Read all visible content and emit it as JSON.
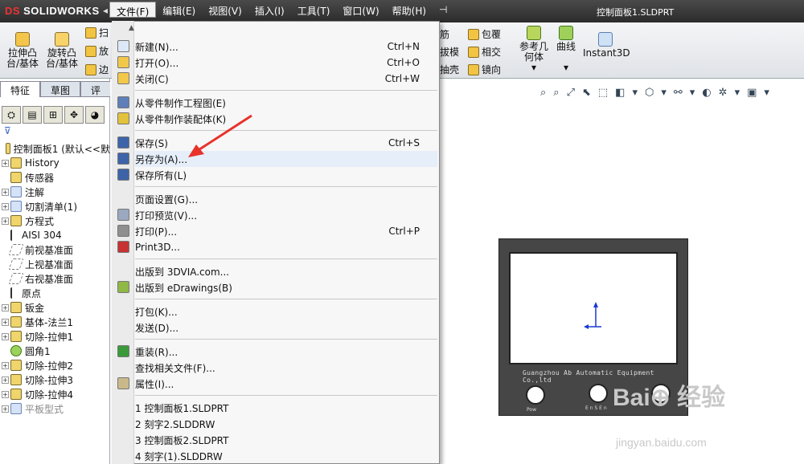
{
  "app": {
    "logo": "SOLIDWORKS",
    "logo_mark": "DS",
    "doc_title": "控制面板1.SLDPRT",
    "collapse": "◂"
  },
  "menubar": [
    {
      "label": "文件(F)",
      "active": true
    },
    {
      "label": "编辑(E)"
    },
    {
      "label": "视图(V)"
    },
    {
      "label": "插入(I)"
    },
    {
      "label": "工具(T)"
    },
    {
      "label": "窗口(W)"
    },
    {
      "label": "帮助(H)"
    },
    {
      "label": "⊣"
    }
  ],
  "commands": {
    "extrude_boss": [
      "拉伸凸",
      "台/基体"
    ],
    "revolve_boss": [
      "旋转凸",
      "台/基体"
    ],
    "frag1": "扫",
    "frag2": "放",
    "frag3": "边",
    "rib": "筋",
    "draft": "拔模",
    "shell": "抽壳",
    "wrap": "包覆",
    "intersect": "相交",
    "mirror": "镜向",
    "ref_geom": [
      "参考几",
      "何体"
    ],
    "curves": "曲线",
    "instant3d": "Instant3D",
    "dropdown": "▾"
  },
  "panel_tabs": [
    "特征",
    "草图",
    "评"
  ],
  "feature_icons": [
    "⛭",
    "▤",
    "⊞",
    "✥",
    "◕"
  ],
  "filter_icon": "⊽",
  "tree": [
    {
      "label": "控制面板1 (默认<<默",
      "pm": "",
      "icon": "part"
    },
    {
      "label": "History",
      "pm": "+",
      "icon": "folder"
    },
    {
      "label": "传感器",
      "pm": "",
      "icon": "folder"
    },
    {
      "label": "注解",
      "pm": "+",
      "icon": "annot"
    },
    {
      "label": "切割清单(1)",
      "pm": "+",
      "icon": "blue"
    },
    {
      "label": "方程式",
      "pm": "+",
      "icon": "folder"
    },
    {
      "label": "AISI 304",
      "pm": "",
      "icon": "material"
    },
    {
      "label": "前视基准面",
      "pm": "",
      "icon": "plane"
    },
    {
      "label": "上视基准面",
      "pm": "",
      "icon": "plane"
    },
    {
      "label": "右视基准面",
      "pm": "",
      "icon": "plane"
    },
    {
      "label": "原点",
      "pm": "",
      "icon": "origin"
    },
    {
      "label": "钣金",
      "pm": "+",
      "icon": "folder"
    },
    {
      "label": "基体-法兰1",
      "pm": "+",
      "icon": "folder"
    },
    {
      "label": "切除-拉伸1",
      "pm": "+",
      "icon": "folder"
    },
    {
      "label": "圆角1",
      "pm": "",
      "icon": "green"
    },
    {
      "label": "切除-拉伸2",
      "pm": "+",
      "icon": "folder"
    },
    {
      "label": "切除-拉伸3",
      "pm": "+",
      "icon": "folder"
    },
    {
      "label": "切除-拉伸4",
      "pm": "+",
      "icon": "folder"
    },
    {
      "label": "平板型式",
      "pm": "+",
      "icon": "blue",
      "gray": true
    }
  ],
  "file_menu": {
    "up": "▲",
    "items": [
      {
        "label": "新建(N)...",
        "key": "Ctrl+N",
        "color": "#dde8f7"
      },
      {
        "label": "打开(O)...",
        "key": "Ctrl+O",
        "color": "#f2c84b"
      },
      {
        "label": "关闭(C)",
        "key": "Ctrl+W",
        "color": "#f2c84b"
      },
      {
        "sep": true
      },
      {
        "label": "从零件制作工程图(E)",
        "key": "",
        "color": "#5e7fb8"
      },
      {
        "label": "从零件制作装配体(K)",
        "key": "",
        "color": "#e2c23a"
      },
      {
        "sep": true
      },
      {
        "label": "保存(S)",
        "key": "Ctrl+S",
        "color": "#3d64a8"
      },
      {
        "label": "另存为(A)...",
        "key": "",
        "color": "#3d64a8",
        "hl": true
      },
      {
        "label": "保存所有(L)",
        "key": "",
        "color": "#3d64a8"
      },
      {
        "sep": true
      },
      {
        "label": "页面设置(G)...",
        "key": "",
        "color": ""
      },
      {
        "label": "打印预览(V)...",
        "key": "",
        "color": "#9aa9c0"
      },
      {
        "label": "打印(P)...",
        "key": "Ctrl+P",
        "color": "#8f8f8f"
      },
      {
        "label": "Print3D...",
        "key": "",
        "color": "#c73333"
      },
      {
        "sep": true
      },
      {
        "label": "出版到 3DVIA.com...",
        "key": "",
        "color": ""
      },
      {
        "label": "出版到 eDrawings(B)",
        "key": "",
        "color": "#8fb845"
      },
      {
        "sep": true
      },
      {
        "label": "打包(K)...",
        "key": "",
        "color": ""
      },
      {
        "label": "发送(D)...",
        "key": "",
        "color": ""
      },
      {
        "sep": true
      },
      {
        "label": "重装(R)...",
        "key": "",
        "color": "#3a9a3a"
      },
      {
        "label": "查找相关文件(F)...",
        "key": "",
        "color": ""
      },
      {
        "label": "属性(I)...",
        "key": "",
        "color": "#c9b98a"
      },
      {
        "sep": true
      },
      {
        "label": "1 控制面板1.SLDPRT",
        "key": "",
        "color": ""
      },
      {
        "label": "2 刻字2.SLDDRW",
        "key": "",
        "color": ""
      },
      {
        "label": "3 控制面板2.SLDPRT",
        "key": "",
        "color": ""
      },
      {
        "label": "4 刻字(1).SLDDRW",
        "key": "",
        "color": ""
      }
    ]
  },
  "view_toolbar": [
    "⌕",
    "⌕",
    "⤢",
    "⬉",
    "⬚",
    "◧",
    "▾",
    "⬡",
    "▾",
    "⚯",
    "▾",
    "◐",
    "✲",
    "▾",
    "▣",
    "▾"
  ],
  "model": {
    "engraving": "Guangzhou Ab Automatic Equipment Co.,ltd",
    "label_left": "Pow",
    "label_mid": "E n S E n"
  },
  "watermark": {
    "brand": "Bai⊕ 经验",
    "url": "jingyan.baidu.com"
  }
}
